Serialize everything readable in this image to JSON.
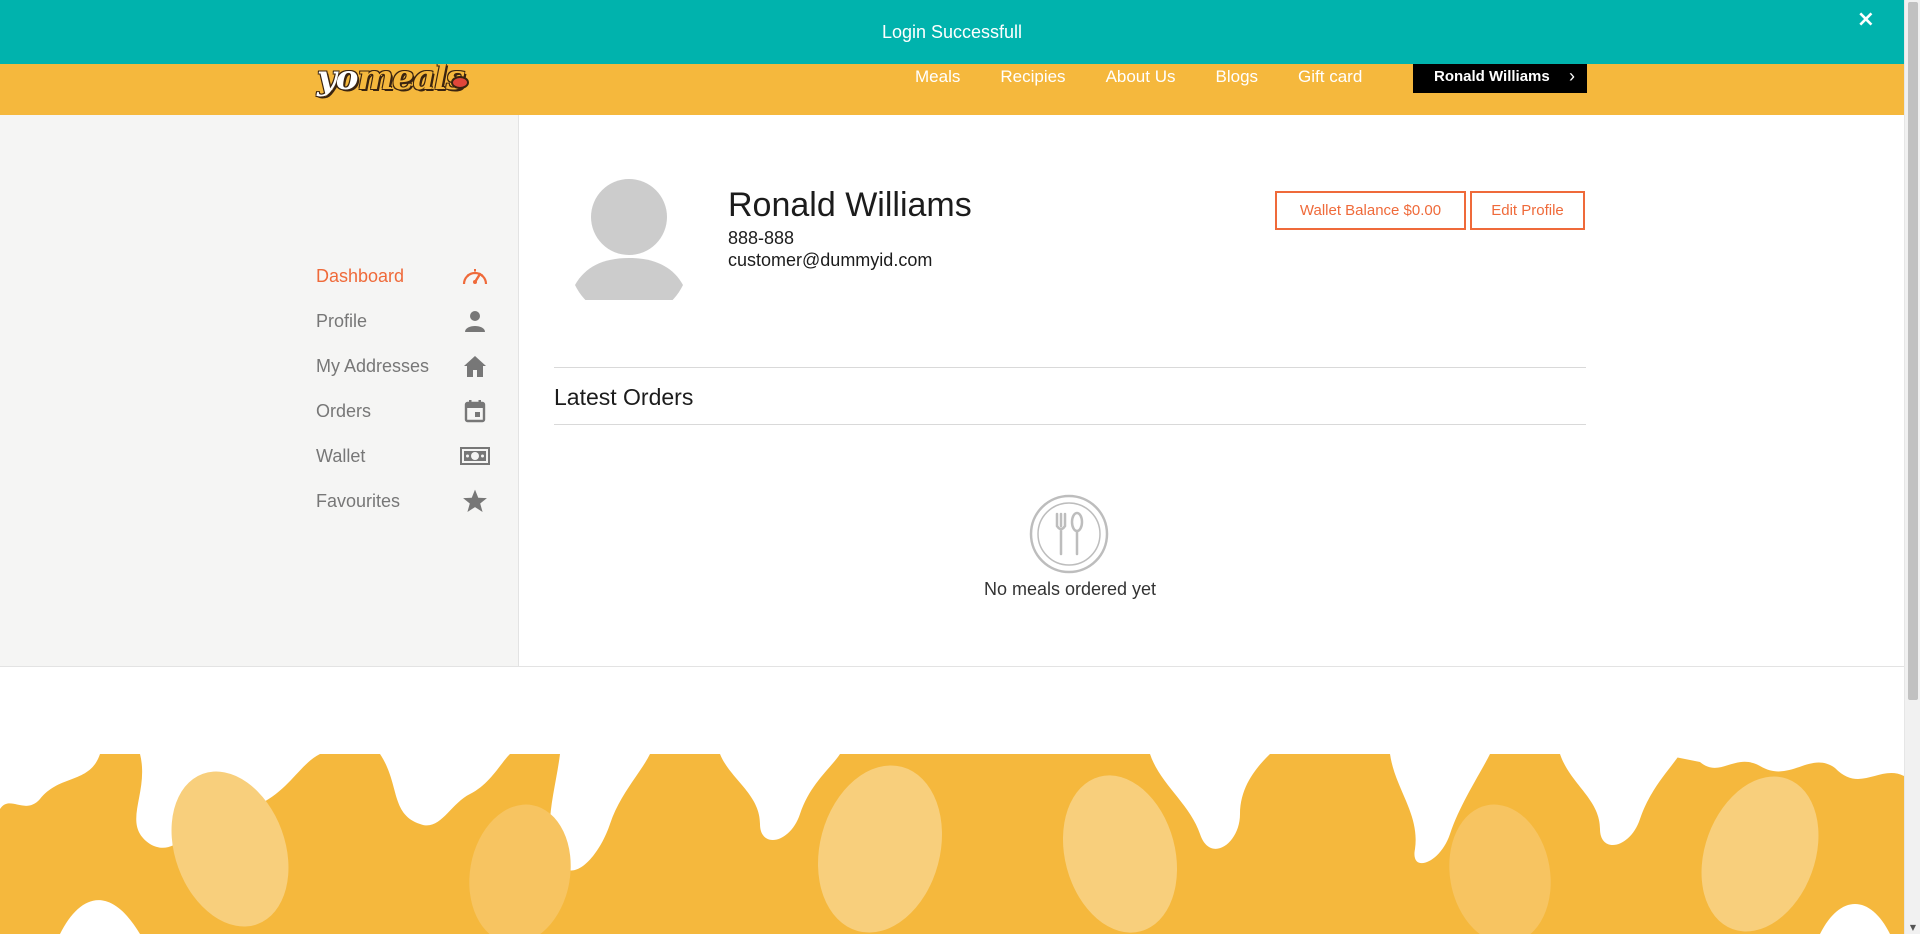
{
  "toast": {
    "message": "Login Successfull",
    "close_glyph": "×"
  },
  "brand": {
    "logo_prefix": "yo",
    "logo_suffix": "meals",
    "primary": "#f5b83d",
    "accent": "#ef6a3a",
    "toast_color": "#00b3ad"
  },
  "nav": {
    "links": [
      {
        "label": "Meals"
      },
      {
        "label": "Recipies"
      },
      {
        "label": "About Us"
      },
      {
        "label": "Blogs"
      },
      {
        "label": "Gift card"
      }
    ],
    "user_button": {
      "label": "Ronald Williams",
      "chevron": "›"
    }
  },
  "sidebar": {
    "items": [
      {
        "label": "Dashboard",
        "icon": "speedometer-icon",
        "active": true
      },
      {
        "label": "Profile",
        "icon": "user-icon",
        "active": false
      },
      {
        "label": "My Addresses",
        "icon": "home-icon",
        "active": false
      },
      {
        "label": "Orders",
        "icon": "calendar-icon",
        "active": false
      },
      {
        "label": "Wallet",
        "icon": "money-icon",
        "active": false
      },
      {
        "label": "Favourites",
        "icon": "star-icon",
        "active": false
      }
    ]
  },
  "profile": {
    "name": "Ronald Williams",
    "phone": "888-888",
    "email": "customer@dummyid.com",
    "wallet_button": "Wallet Balance $0.00",
    "edit_button": "Edit Profile"
  },
  "orders": {
    "title": "Latest Orders",
    "empty_message": "No meals ordered yet",
    "empty_icon": "cutlery-icon"
  }
}
